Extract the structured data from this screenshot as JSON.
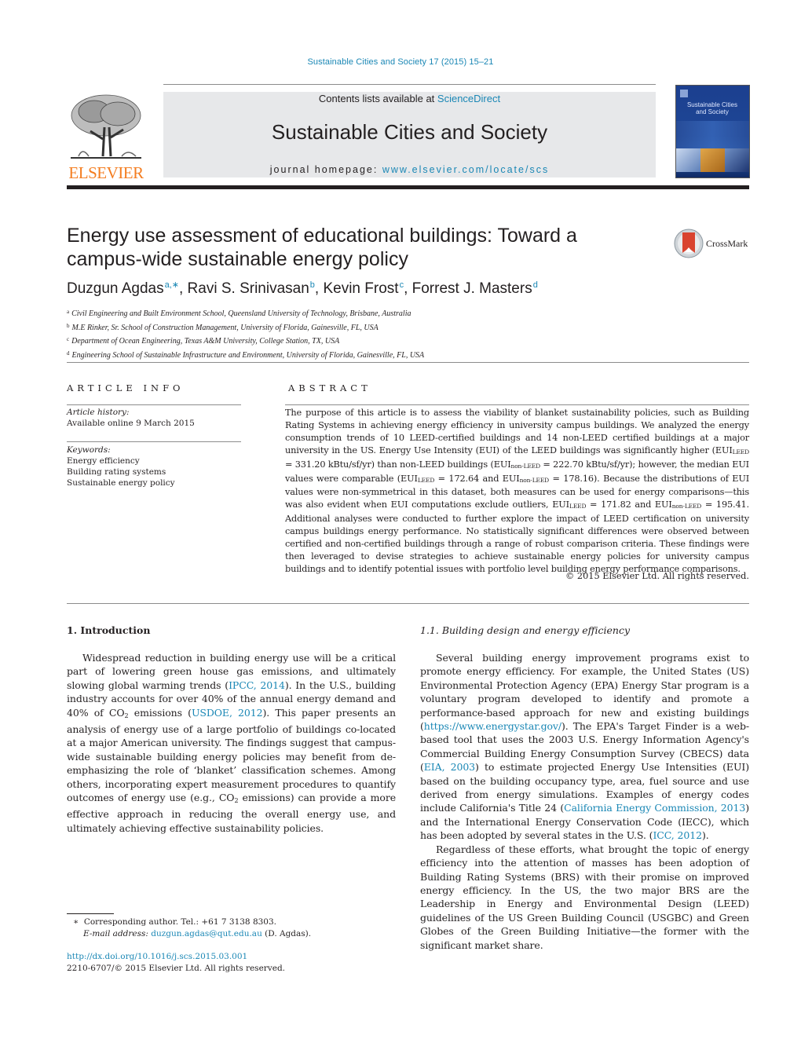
{
  "header": {
    "citation": "Sustainable Cities and Society 17 (2015) 15–21",
    "contents_prefix": "Contents lists available at ",
    "contents_link": "ScienceDirect",
    "journal_title": "Sustainable Cities and Society",
    "homepage_prefix": "journal homepage: ",
    "homepage_link": "www.elsevier.com/locate/scs",
    "publisher_logo": "ELSEVIER",
    "cover_title_line1": "Sustainable Cities",
    "cover_title_line2": "and Society"
  },
  "article": {
    "title_line1": "Energy use assessment of educational buildings: Toward a",
    "title_line2": "campus-wide sustainable energy policy",
    "crossmark_label": "CrossMark",
    "authors": [
      {
        "name": "Duzgun Agdas",
        "sup": "a,∗",
        "sep": ", "
      },
      {
        "name": "Ravi S. Srinivasan",
        "sup": "b",
        "sep": ", "
      },
      {
        "name": "Kevin Frost",
        "sup": "c",
        "sep": ", "
      },
      {
        "name": "Forrest J. Masters",
        "sup": "d",
        "sep": ""
      }
    ],
    "affiliations": [
      {
        "key": "a",
        "text": "Civil Engineering and Built Environment School, Queensland University of Technology, Brisbane, Australia"
      },
      {
        "key": "b",
        "text": "M.E Rinker, Sr. School of Construction Management, University of Florida, Gainesville, FL, USA"
      },
      {
        "key": "c",
        "text": "Department of Ocean Engineering, Texas A&M University, College Station, TX, USA"
      },
      {
        "key": "d",
        "text": "Engineering School of Sustainable Infrastructure and Environment, University of Florida, Gainesville, FL, USA"
      }
    ]
  },
  "article_info": {
    "heading": "ARTICLE INFO",
    "history_label": "Article history:",
    "history_value": "Available online 9 March 2015",
    "keywords_label": "Keywords:",
    "keywords": [
      "Energy efficiency",
      "Building rating systems",
      "Sustainable energy policy"
    ]
  },
  "abstract": {
    "heading": "ABSTRACT",
    "p1": "The purpose of this article is to assess the viability of blanket sustainability policies, such as Building Rating Systems in achieving energy efficiency in university campus buildings. We analyzed the energy consumption trends of 10 LEED-certified buildings and 14 non-LEED certified buildings at a major university in the US. Energy Use Intensity (EUI) of the LEED buildings was significantly higher (EUI",
    "s1": "LEED",
    "p2": " = 331.20 kBtu/sf/yr) than non-LEED buildings (EUI",
    "s2": "non-LEED",
    "p3": " = 222.70 kBtu/sf/yr); however, the median EUI values were comparable (EUI",
    "s3": "LEED",
    "p4": " = 172.64 and EUI",
    "s4": "non-LEED",
    "p5": " = 178.16). Because the distributions of EUI values were non-symmetrical in this dataset, both measures can be used for energy comparisons—this was also evident when EUI computations exclude outliers, EUI",
    "s5": "LEED",
    "p6": " = 171.82 and EUI",
    "s6": "non-LEED",
    "p7": " = 195.41. Additional analyses were conducted to further explore the impact of LEED certification on university campus buildings energy performance. No statistically significant differences were observed between certified and non-certified buildings through a range of robust comparison criteria. These findings were then leveraged to devise strategies to achieve sustainable energy policies for university campus buildings and to identify potential issues with portfolio level building energy performance comparisons.",
    "copyright": "© 2015 Elsevier Ltd. All rights reserved."
  },
  "intro": {
    "heading": "1.  Introduction",
    "t1": "Widespread reduction in building energy use will be a critical part of lowering green house gas emissions, and ultimately slowing global warming trends (",
    "l1": "IPCC, 2014",
    "t2": "). In the U.S., building industry accounts for over 40% of the annual energy demand and 40% of CO",
    "t3": " emissions (",
    "l2": "USDOE, 2012",
    "t4": "). This paper presents an analysis of energy use of a large portfolio of buildings co-located at a major American university. The findings suggest that campus-wide sustainable building energy policies may benefit from de-emphasizing the role of ‘blanket’ classification schemes. Among others, incorporating expert measurement procedures to quantify outcomes of energy use (e.g., CO",
    "t5": " emissions) can provide a more effective approach in reducing the overall energy use, and ultimately achieving effective sustainability policies.",
    "sub2": "2"
  },
  "section_1_1": {
    "heading": "1.1.  Building design and energy efficiency",
    "t1": "Several building energy improvement programs exist to promote energy efficiency. For example, the United States (US) Environmental Protection Agency (EPA) Energy Star program is a voluntary program developed to identify and promote a performance-based approach for new and existing buildings (",
    "l1": "https://www.energystar.gov/",
    "t2": "). The EPA's Target Finder is a web-based tool that uses the 2003 U.S. Energy Information Agency's Commercial Building Energy Consumption Survey (CBECS) data (",
    "l2": "EIA, 2003",
    "t3": ") to estimate projected Energy Use Intensities (EUI) based on the building occupancy type, area, fuel source and use derived from energy simulations. Examples of energy codes include California's Title 24 (",
    "l3": "California Energy Commission, 2013",
    "t4": ") and the International Energy Conservation Code (IECC), which has been adopted by several states in the U.S. (",
    "l4": "ICC, 2012",
    "t5": ").",
    "p2": "Regardless of these efforts, what brought the topic of energy efficiency into the attention of masses has been adoption of Building Rating Systems (BRS) with their promise on improved energy efficiency. In the US, the two major BRS are the Leadership in Energy and Environmental Design (LEED) guidelines of the US Green Building Council (USGBC) and Green Globes of the Green Building Initiative—the former with the significant market share."
  },
  "footnotes": {
    "star": "∗",
    "corresponding": "Corresponding author. Tel.: +61 7 3138 8303.",
    "email_label": "E-mail address:",
    "email": "duzgun.agdas@qut.edu.au",
    "email_suffix": " (D. Agdas).",
    "doi": "http://dx.doi.org/10.1016/j.scs.2015.03.001",
    "issn": "2210-6707/© 2015 Elsevier Ltd. All rights reserved."
  },
  "colors": {
    "link": "#1a87b5",
    "elsevier_orange": "#f47d20",
    "banner_gray": "#e7e8ea",
    "crossmark_red": "#d9432f"
  }
}
